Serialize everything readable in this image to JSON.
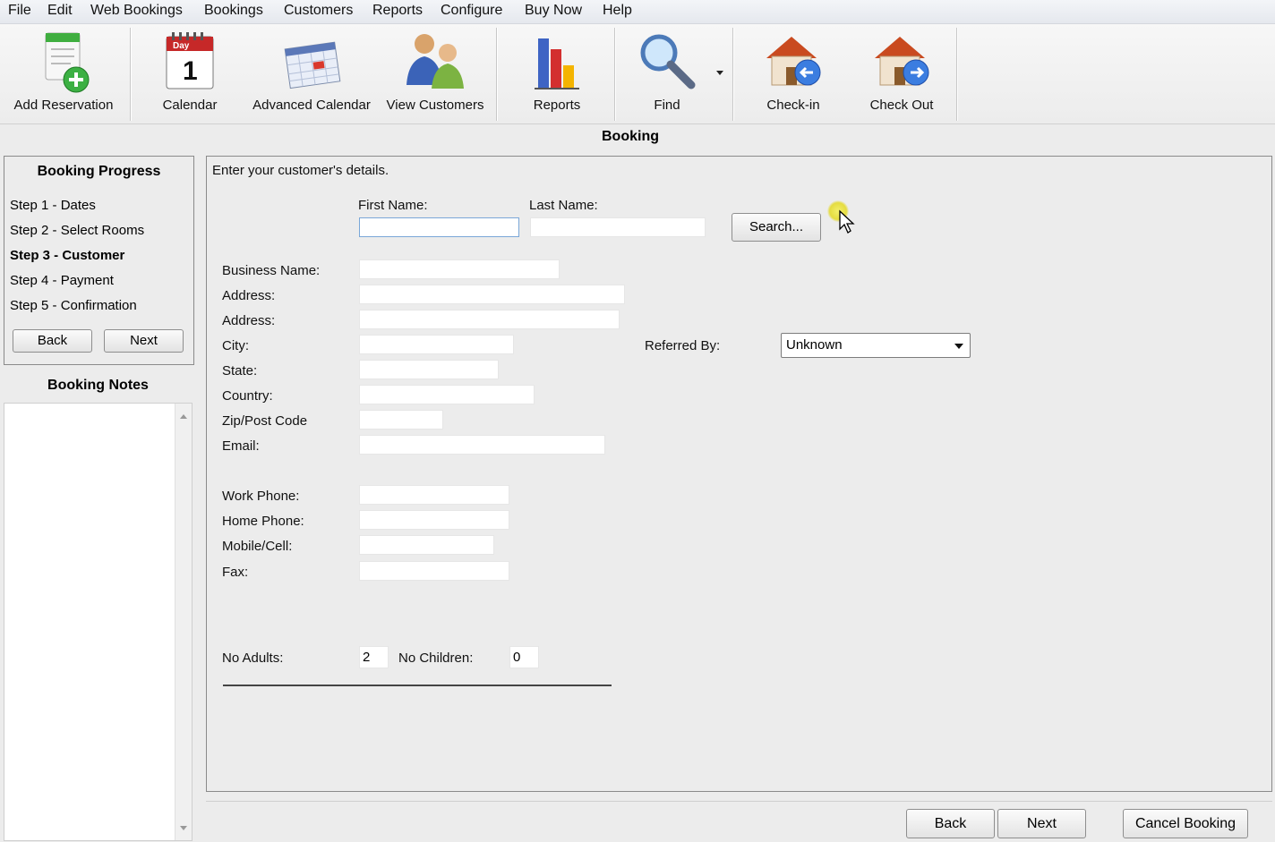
{
  "menu": [
    "File",
    "Edit",
    "Web Bookings",
    "Bookings",
    "Customers",
    "Reports",
    "Configure",
    "Buy Now",
    "Help"
  ],
  "toolbar": {
    "add_reservation": "Add Reservation",
    "calendar": "Calendar",
    "calendar_icon_day": "Day",
    "calendar_icon_number": "1",
    "advanced_calendar": "Advanced Calendar",
    "view_customers": "View Customers",
    "reports": "Reports",
    "find": "Find",
    "check_in": "Check-in",
    "check_out": "Check Out"
  },
  "section_title": "Booking",
  "progress": {
    "title": "Booking Progress",
    "steps": [
      "Step 1 - Dates",
      "Step 2 - Select Rooms",
      "Step 3  - Customer",
      "Step 4 - Payment",
      "Step 5 - Confirmation"
    ],
    "active_step": 3,
    "back": "Back",
    "next": "Next"
  },
  "notes": {
    "title": "Booking Notes",
    "value": ""
  },
  "form": {
    "instruction": "Enter your customer's details.",
    "first_name_label": "First Name:",
    "first_name": "",
    "last_name_label": "Last Name:",
    "last_name": "",
    "search": "Search...",
    "business_name_label": "Business Name:",
    "address1_label": "Address:",
    "address2_label": "Address:",
    "city_label": "City:",
    "state_label": "State:",
    "country_label": "Country:",
    "zip_label": "Zip/Post Code",
    "email_label": "Email:",
    "work_phone_label": "Work Phone:",
    "home_phone_label": "Home Phone:",
    "mobile_label": "Mobile/Cell:",
    "fax_label": "Fax:",
    "referred_by_label": "Referred By:",
    "referred_by_value": "Unknown",
    "no_adults_label": "No Adults:",
    "no_adults": "2",
    "no_children_label": "No Children:",
    "no_children": "0"
  },
  "footer": {
    "back": "Back",
    "next": "Next",
    "cancel": "Cancel Booking"
  },
  "colors": {
    "focus_border": "#7aa7d8",
    "panel_bg": "#ececec"
  }
}
